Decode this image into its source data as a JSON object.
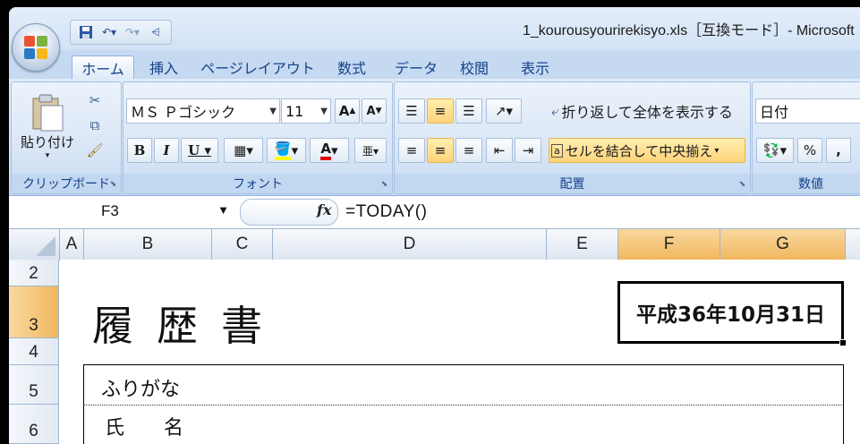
{
  "app": {
    "title": "1_kourousyourirekisyo.xls［互換モード］- Microsoft"
  },
  "tabs": [
    {
      "label": "ホーム",
      "active": true
    },
    {
      "label": "挿入"
    },
    {
      "label": "ページレイアウト"
    },
    {
      "label": "数式"
    },
    {
      "label": "データ"
    },
    {
      "label": "校閲"
    },
    {
      "label": "表示"
    }
  ],
  "ribbon": {
    "clipboard": {
      "paste_label": "貼り付け",
      "group_label": "クリップボード"
    },
    "font": {
      "font_name": "ＭＳ Ｐゴシック",
      "font_size": "11",
      "group_label": "フォント"
    },
    "alignment": {
      "wrap_label": "折り返して全体を表示する",
      "merge_label": "セルを結合して中央揃え",
      "group_label": "配置"
    },
    "number": {
      "format": "日付",
      "percent": "%",
      "comma": ",",
      "group_label": "数値"
    }
  },
  "formula_bar": {
    "name_box": "F3",
    "fx": "fx",
    "formula": "=TODAY()"
  },
  "columns": [
    "A",
    "B",
    "C",
    "D",
    "E",
    "F",
    "G"
  ],
  "rows": [
    "2",
    "3",
    "4",
    "5",
    "6"
  ],
  "cells": {
    "title": "履歴書",
    "date": "平成36年10月31日",
    "furigana": "ふりがな",
    "name": "氏　　名"
  },
  "colors": {
    "selected_header": "#f1b75e",
    "ribbon_bg": "#d3e2f5",
    "tab_text": "#15428b"
  }
}
